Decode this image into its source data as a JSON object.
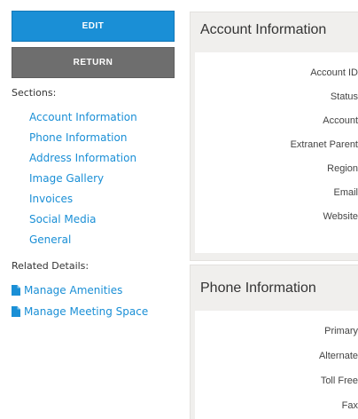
{
  "actions": {
    "edit_label": "EDIT",
    "return_label": "RETURN"
  },
  "sidebar": {
    "sections_heading": "Sections:",
    "sections": [
      "Account Information",
      "Phone Information",
      "Address Information",
      "Image Gallery",
      "Invoices",
      "Social Media",
      "General"
    ],
    "related_heading": "Related Details:",
    "related": [
      {
        "label": "Manage Amenities",
        "icon": "document-icon"
      },
      {
        "label": "Manage Meeting Space",
        "icon": "document-icon"
      }
    ]
  },
  "account_panel": {
    "title": "Account Information",
    "fields": [
      "Account ID",
      "Status",
      "Account",
      "Extranet Parent",
      "Region",
      "Email",
      "Website"
    ]
  },
  "phone_panel": {
    "title": "Phone Information",
    "fields": [
      "Primary",
      "Alternate",
      "Toll Free",
      "Fax"
    ]
  },
  "colors": {
    "accent": "#1a8fd6",
    "return_button": "#6e6e6e",
    "panel_header": "#f0efed"
  }
}
